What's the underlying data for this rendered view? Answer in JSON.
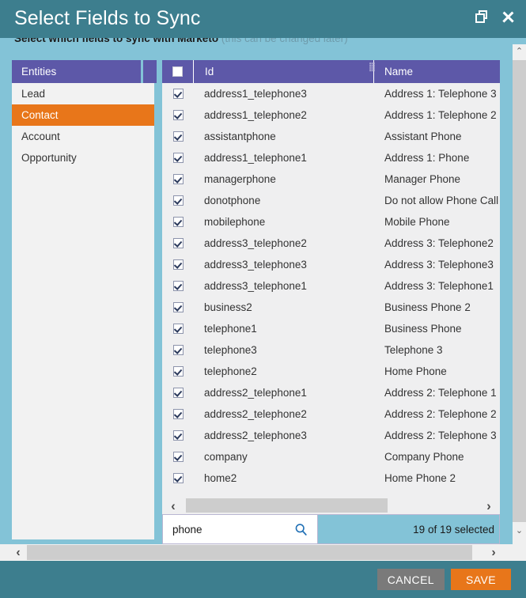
{
  "window": {
    "title": "Select Fields to Sync",
    "restore_icon": "restore-window-icon",
    "close_icon": "close-icon"
  },
  "subtitle": {
    "strong": "Select which fields to sync with Marketo",
    "muted": "(this can be changed later)"
  },
  "sidebar": {
    "header": "Entities",
    "items": [
      {
        "label": "Lead",
        "active": false
      },
      {
        "label": "Contact",
        "active": true
      },
      {
        "label": "Account",
        "active": false
      },
      {
        "label": "Opportunity",
        "active": false
      }
    ]
  },
  "grid": {
    "columns": {
      "id": "Id",
      "name": "Name"
    },
    "select_all_checked": false,
    "rows": [
      {
        "id": "address1_telephone3",
        "name": "Address 1: Telephone 3",
        "checked": true
      },
      {
        "id": "address1_telephone2",
        "name": "Address 1: Telephone 2",
        "checked": true
      },
      {
        "id": "assistantphone",
        "name": "Assistant Phone",
        "checked": true
      },
      {
        "id": "address1_telephone1",
        "name": "Address 1: Phone",
        "checked": true
      },
      {
        "id": "managerphone",
        "name": "Manager Phone",
        "checked": true
      },
      {
        "id": "donotphone",
        "name": "Do not allow Phone Call",
        "checked": true
      },
      {
        "id": "mobilephone",
        "name": "Mobile Phone",
        "checked": true
      },
      {
        "id": "address3_telephone2",
        "name": "Address 3: Telephone2",
        "checked": true
      },
      {
        "id": "address3_telephone3",
        "name": "Address 3: Telephone3",
        "checked": true
      },
      {
        "id": "address3_telephone1",
        "name": "Address 3: Telephone1",
        "checked": true
      },
      {
        "id": "business2",
        "name": "Business Phone 2",
        "checked": true
      },
      {
        "id": "telephone1",
        "name": "Business Phone",
        "checked": true
      },
      {
        "id": "telephone3",
        "name": "Telephone 3",
        "checked": true
      },
      {
        "id": "telephone2",
        "name": "Home Phone",
        "checked": true
      },
      {
        "id": "address2_telephone1",
        "name": "Address 2: Telephone 1",
        "checked": true
      },
      {
        "id": "address2_telephone2",
        "name": "Address 2: Telephone 2",
        "checked": true
      },
      {
        "id": "address2_telephone3",
        "name": "Address 2: Telephone 3",
        "checked": true
      },
      {
        "id": "company",
        "name": "Company Phone",
        "checked": true
      },
      {
        "id": "home2",
        "name": "Home Phone 2",
        "checked": true
      }
    ]
  },
  "search": {
    "value": "phone",
    "placeholder": "",
    "icon": "search-icon"
  },
  "status": {
    "selected_text": "19 of 19 selected"
  },
  "footer": {
    "cancel_label": "CANCEL",
    "save_label": "SAVE"
  },
  "scroll": {
    "left_arrow": "‹",
    "right_arrow": "›",
    "up_arrow": "⌃",
    "down_arrow": "⌄"
  },
  "colors": {
    "titlebar": "#3d7e8e",
    "accent_orange": "#e8761a",
    "header_purple": "#5d58a8",
    "body_blue": "#83c3d7",
    "row_grey": "#efeff0",
    "cancel_grey": "#7a7a7a"
  }
}
